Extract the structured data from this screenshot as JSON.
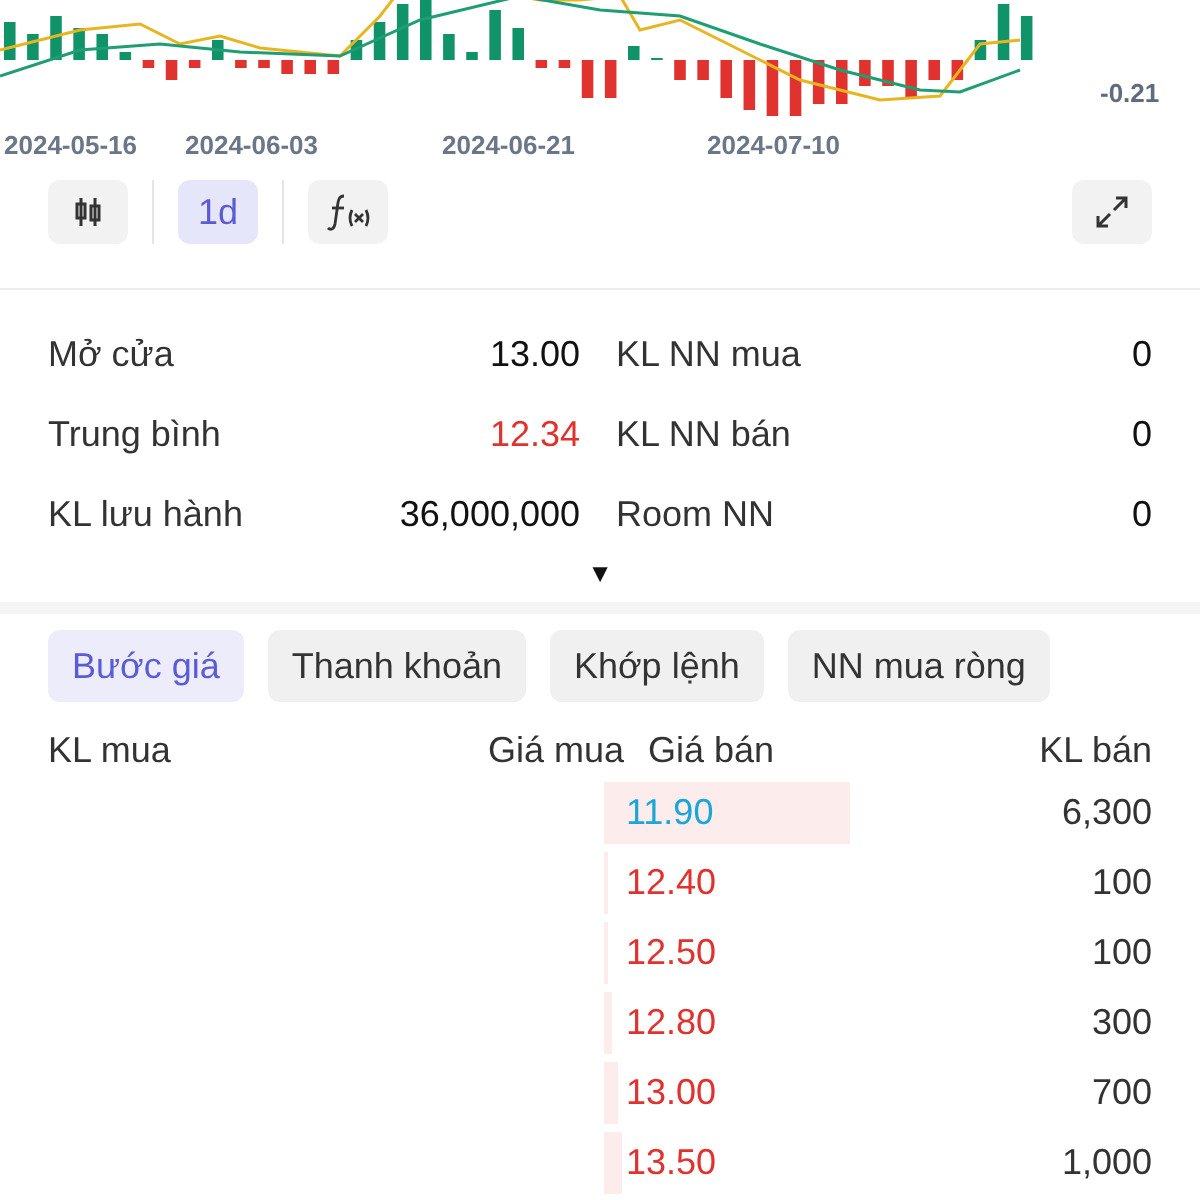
{
  "chart": {
    "axis_value": "-0.21",
    "dates": [
      "2024-05-16",
      "2024-06-03",
      "2024-06-21",
      "2024-07-10"
    ]
  },
  "toolbar": [
    {
      "kind": "candles"
    },
    {
      "kind": "interval",
      "label": "1d",
      "selected": true
    },
    {
      "kind": "formula"
    },
    {
      "kind": "fullscreen"
    }
  ],
  "stats": [
    {
      "label": "Mở cửa",
      "value": "13.00",
      "color": "#111111",
      "label_2": "KL NN mua",
      "value_2": "0"
    },
    {
      "label": "Trung bình",
      "value": "12.34",
      "color": "#e0332f",
      "label_2": "KL NN bán",
      "value_2": "0"
    },
    {
      "label": "KL lưu hành",
      "value": "36,000,000",
      "color": "#111111",
      "label_2": "Room NN",
      "value_2": "0"
    }
  ],
  "expand_toggle": "▼",
  "tabs": [
    {
      "label": "Bước giá",
      "selected": true
    },
    {
      "label": "Thanh khoản",
      "selected": false
    },
    {
      "label": "Khớp lệnh",
      "selected": false
    },
    {
      "label": "NN mua ròng",
      "selected": false
    }
  ],
  "order_book": {
    "columns": [
      "KL mua",
      "Giá mua",
      "Giá bán",
      "KL bán"
    ],
    "asks": [
      {
        "price": "11.90",
        "volume": "6,300",
        "color": "#1aa7d8"
      },
      {
        "price": "12.40",
        "volume": "100",
        "color": "#e0332f"
      },
      {
        "price": "12.50",
        "volume": "100",
        "color": "#e0332f"
      },
      {
        "price": "12.80",
        "volume": "300",
        "color": "#e0332f"
      },
      {
        "price": "13.00",
        "volume": "700",
        "color": "#e0332f"
      },
      {
        "price": "13.50",
        "volume": "1,000",
        "color": "#e0332f"
      }
    ]
  }
}
